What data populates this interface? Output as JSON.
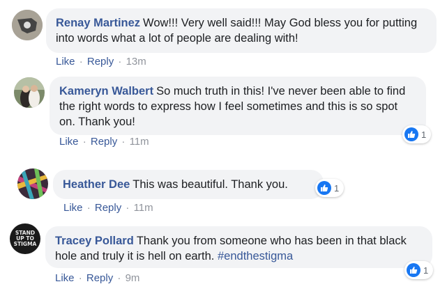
{
  "comments": [
    {
      "author": "Renay Martinez",
      "text": "Wow!!! Very well said!!! May God bless you for putting into words what a lot of people are dealing with!",
      "like": "Like",
      "reply": "Reply",
      "time": "13m",
      "sep": "·"
    },
    {
      "author": "Kameryn Walbert",
      "text": "So much truth in this! I've never been able to find the right words to express how I feel sometimes and this is so spot on. Thank you!",
      "like": "Like",
      "reply": "Reply",
      "time": "11m",
      "sep": "·",
      "reactions": "1"
    },
    {
      "author": "Heather Dee",
      "text": "This was beautiful. Thank you.",
      "like": "Like",
      "reply": "Reply",
      "time": "11m",
      "sep": "·",
      "reactions": "1"
    },
    {
      "author": "Tracey Pollard",
      "text": "Thank you from someone who has been in that black hole and truly it is hell on earth.",
      "hashtag": "#endthestigma",
      "like": "Like",
      "reply": "Reply",
      "time": "9m",
      "sep": "·",
      "reactions": "1",
      "avatar_text": "STAND UP TO STIGMA"
    }
  ],
  "colors": {
    "link": "#385898",
    "bubble": "#f2f3f5",
    "meta": "#90949c",
    "like_blue": "#1877f2"
  },
  "icons": [
    "like-thumb-icon"
  ]
}
